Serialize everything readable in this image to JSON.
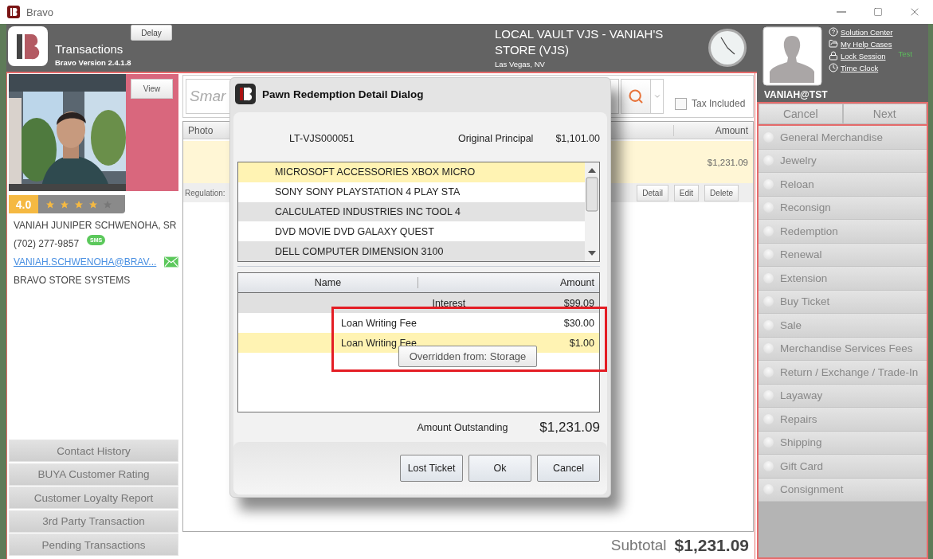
{
  "window": {
    "title": "Bravo"
  },
  "header": {
    "delay_button": "Delay",
    "title": "Transactions",
    "version": "Bravo Version 2.4.1.8",
    "store_name": "LOCAL VAULT VJS - VANIAH'S STORE (VJS)",
    "store_location": "Las Vegas, NV"
  },
  "user": {
    "links": [
      {
        "kind": "help",
        "label": "Solution Center"
      },
      {
        "kind": "folder",
        "label": "My Help Cases"
      },
      {
        "kind": "lock",
        "label": "Lock Session"
      },
      {
        "kind": "clock",
        "label": "Time Clock"
      }
    ],
    "env_label": "Test",
    "username": "VANIAH@TST",
    "actions": [
      "Cancel",
      "Next"
    ]
  },
  "customer": {
    "view_button": "View",
    "rating": "4.0",
    "stars": 4,
    "name": "VANIAH JUNIPER SCHWENOHA, SR",
    "phone": "(702) 277-9857",
    "phone_badge": "SMS",
    "email": "VANIAH.SCHWENOHA@BRAV...",
    "company": "BRAVO STORE SYSTEMS",
    "actions": [
      "Contact History",
      "BUYA Customer Rating",
      "Customer Loyalty Report",
      "3rd Party Transaction",
      "Pending Transactions"
    ]
  },
  "transaction": {
    "search_placeholder": "Smar",
    "tax_included": {
      "label": "Tax Included",
      "checked": false
    },
    "columns": [
      "Photo",
      "Amount"
    ],
    "rows": [
      {
        "amount": "$1,231.09",
        "selected": true
      }
    ],
    "regulation_label": "Regulation:",
    "row_actions": [
      "Detail",
      "Edit",
      "Delete"
    ],
    "subtotal_label": "Subtotal",
    "subtotal": "$1,231.09"
  },
  "transaction_types": [
    {
      "label": "General Merchandise",
      "selected": false
    },
    {
      "label": "Jewelry",
      "selected": false
    },
    {
      "label": "Reloan",
      "selected": false
    },
    {
      "label": "Reconsign",
      "selected": false
    },
    {
      "label": "Redemption",
      "selected": false
    },
    {
      "label": "Renewal",
      "selected": false
    },
    {
      "label": "Extension",
      "selected": false
    },
    {
      "label": "Buy Ticket",
      "selected": false
    },
    {
      "label": "Sale",
      "selected": false
    },
    {
      "label": "Merchandise Services Fees",
      "selected": false
    },
    {
      "label": "Return / Exchange / Trade-In",
      "selected": false
    },
    {
      "label": "Layaway",
      "selected": false
    },
    {
      "label": "Repairs",
      "selected": false
    },
    {
      "label": "Shipping",
      "selected": false
    },
    {
      "label": "Gift Card",
      "selected": false
    },
    {
      "label": "Consignment",
      "selected": false
    }
  ],
  "dialog": {
    "title": "Pawn Redemption Detail Dialog",
    "ticket": "LT-VJS000051",
    "principal_label": "Original Principal",
    "principal": "$1,101.00",
    "items": [
      {
        "label": "MICROSOFT ACCESSORIES XBOX MICRO",
        "selected": true
      },
      {
        "label": "SONY SONY PLAYSTATION 4 PLAY STA",
        "selected": false
      },
      {
        "label": "CALCULATED INDUSTRIES INC TOOL 4",
        "selected": false
      },
      {
        "label": "DVD MOVIE DVD GALAXY QUEST",
        "selected": false
      },
      {
        "label": "DELL COMPUTER DIMENSION 3100",
        "selected": false
      }
    ],
    "fee_columns": [
      "Name",
      "Amount"
    ],
    "fees": [
      {
        "kind": "group",
        "name": "Interest",
        "amount": "$99.09",
        "selected": false
      },
      {
        "kind": "fee",
        "name": "Loan Writing Fee",
        "amount": "$30.00",
        "selected": false
      },
      {
        "kind": "fee",
        "name": "Loan Writing Fee",
        "amount": "$1.00",
        "selected": true
      }
    ],
    "tooltip": "Overridden from: Storage",
    "outstanding_label": "Amount Outstanding",
    "outstanding": "$1,231.09",
    "buttons": [
      "Lost Ticket",
      "Ok",
      "Cancel"
    ]
  }
}
